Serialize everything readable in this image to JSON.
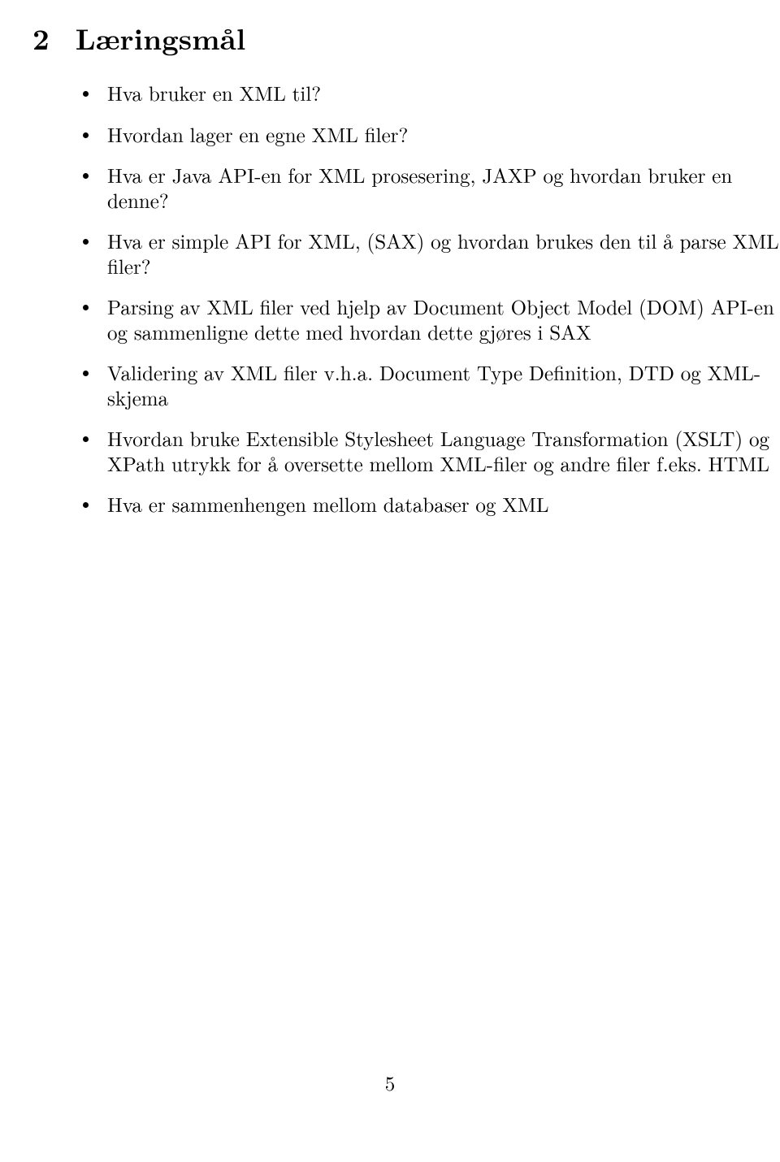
{
  "heading": {
    "number": "2",
    "title": "Læringsmål"
  },
  "items": [
    "Hva bruker en XML til?",
    "Hvordan lager en egne XML filer?",
    "Hva er Java API-en for XML prosesering, JAXP og hvordan bruker en denne?",
    "Hva er simple API for XML, (SAX) og hvordan brukes den til å parse XML filer?",
    "Parsing av XML filer ved hjelp av Document Object Model (DOM) API-en og sammenligne dette med hvordan dette gjøres i SAX",
    "Validering av XML filer v.h.a. Document Type Definition, DTD og XML-skjema",
    "Hvordan bruke Extensible Stylesheet Language Transformation (XSLT) og XPath utrykk for å oversette mellom XML-filer og andre filer f.eks. HTML",
    "Hva er sammenhengen mellom databaser og XML"
  ],
  "page_number": "5"
}
